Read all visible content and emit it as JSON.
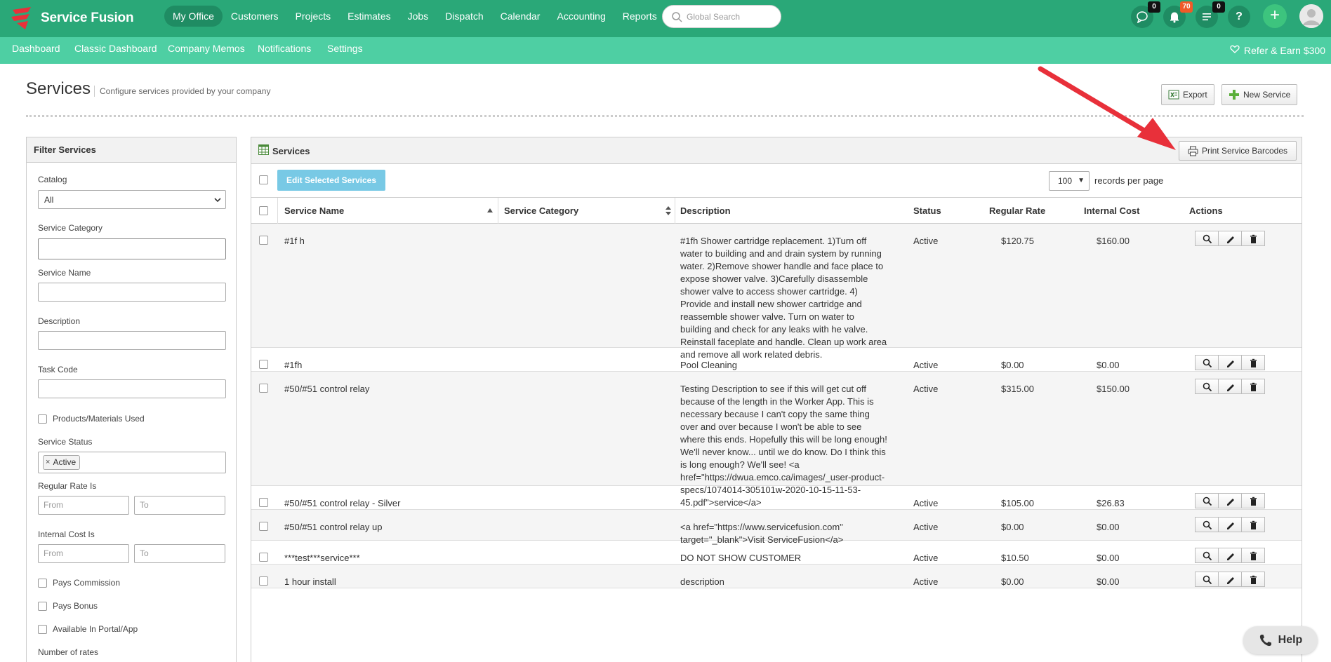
{
  "app": {
    "name": "Service Fusion"
  },
  "nav": {
    "items": [
      "My Office",
      "Customers",
      "Projects",
      "Estimates",
      "Jobs",
      "Dispatch",
      "Calendar",
      "Accounting",
      "Reports"
    ],
    "active": "My Office",
    "search_placeholder": "Global Search",
    "badges": {
      "chat": "0",
      "notifications": "70",
      "tasks": "0"
    },
    "help_glyph": "?",
    "add_glyph": "+"
  },
  "subnav": {
    "items": [
      "Dashboard",
      "Classic Dashboard",
      "Company Memos",
      "Notifications",
      "Settings"
    ],
    "refer": "Refer & Earn $300"
  },
  "page": {
    "title": "Services",
    "subtitle": "Configure services provided by your company",
    "export": "Export",
    "new_service": "New Service"
  },
  "filter": {
    "title": "Filter Services",
    "catalog_label": "Catalog",
    "catalog_value": "All",
    "service_category_label": "Service Category",
    "service_name_label": "Service Name",
    "description_label": "Description",
    "task_code_label": "Task Code",
    "products_used": "Products/Materials Used",
    "service_status_label": "Service Status",
    "status_tag": "Active",
    "regular_rate_label": "Regular Rate Is",
    "internal_cost_label": "Internal Cost Is",
    "from": "From",
    "to": "To",
    "pays_commission": "Pays Commission",
    "pays_bonus": "Pays Bonus",
    "available_portal": "Available In Portal/App",
    "number_of_rates": "Number of rates"
  },
  "services": {
    "title": "Services",
    "print_barcodes": "Print Service Barcodes",
    "edit_selected": "Edit Selected Services",
    "records_value": "100",
    "records_label": "records per page",
    "columns": {
      "name": "Service Name",
      "category": "Service Category",
      "description": "Description",
      "status": "Status",
      "regular_rate": "Regular Rate",
      "internal_cost": "Internal Cost",
      "actions": "Actions"
    },
    "rows": [
      {
        "name": "#1f h",
        "category": "",
        "description": "#1fh Shower cartridge replacement. 1)Turn off water to building and and drain system by running water. 2)Remove shower handle and face place to expose shower valve. 3)Carefully disassemble shower valve to access shower cartridge. 4) Provide and install new shower cartridge and reassemble shower valve. Turn on water to building and check for any leaks with he valve. Reinstall faceplate and handle. Clean up work area and remove all work related debris.",
        "status": "Active",
        "rate": "$120.75",
        "cost": "$160.00"
      },
      {
        "name": "#1fh",
        "category": "",
        "description": "Pool Cleaning",
        "status": "Active",
        "rate": "$0.00",
        "cost": "$0.00"
      },
      {
        "name": "#50/#51 control relay",
        "category": "",
        "description": "Testing Description to see if this will get cut off because of the length in the Worker App. This is necessary because I can't copy the same thing over and over because I won't be able to see where this ends. Hopefully this will be long enough! We'll never know... until we do know. Do I think this is long enough? We'll see! <a href=\"https://dwua.emco.ca/images/_user-product-specs/1074014-305101w-2020-10-15-11-53-45.pdf\">service</a>",
        "status": "Active",
        "rate": "$315.00",
        "cost": "$150.00"
      },
      {
        "name": "#50/#51 control relay - Silver",
        "category": "",
        "description": "",
        "status": "Active",
        "rate": "$105.00",
        "cost": "$26.83"
      },
      {
        "name": "#50/#51 control relay up",
        "category": "",
        "description": "<a href=\"https://www.servicefusion.com\" target=\"_blank\">Visit ServiceFusion</a>",
        "status": "Active",
        "rate": "$0.00",
        "cost": "$0.00"
      },
      {
        "name": "***test***service***",
        "category": "",
        "description": "DO NOT SHOW CUSTOMER",
        "status": "Active",
        "rate": "$10.50",
        "cost": "$0.00"
      },
      {
        "name": "1 hour install",
        "category": "",
        "description": "description",
        "status": "Active",
        "rate": "$0.00",
        "cost": "$0.00"
      }
    ]
  },
  "help": {
    "label": "Help"
  },
  "colors": {
    "nav": "#2aa878",
    "subnav": "#4ecfa3",
    "edit_button": "#78c9e5",
    "annotation_arrow": "#e8303a"
  }
}
